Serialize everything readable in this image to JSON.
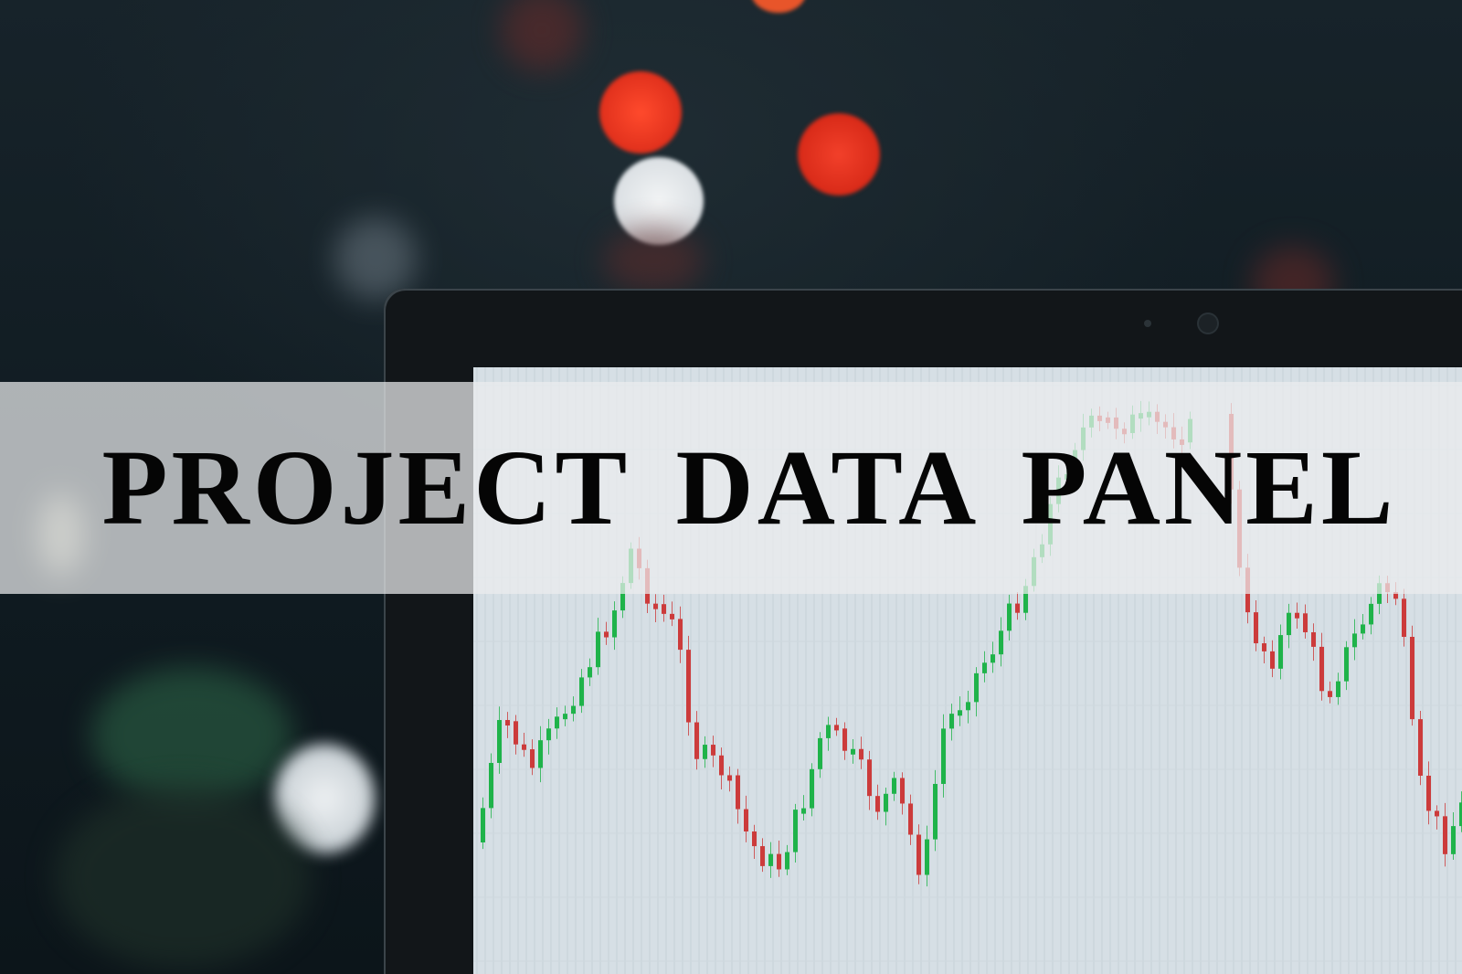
{
  "banner": {
    "title": "PROJECT DATA PANEL"
  },
  "photo": {
    "screen_chart": {
      "type": "candlestick",
      "up_color": "#1fb34a",
      "down_color": "#cc3b3b"
    }
  },
  "colors": {
    "background": "#111c22",
    "screen": "#d6dfe5",
    "bokeh_red": "#e83a22",
    "bokeh_white": "#e8ecef"
  }
}
